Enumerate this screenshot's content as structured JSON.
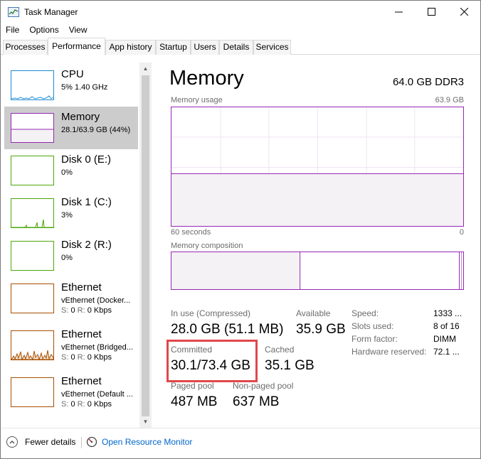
{
  "window": {
    "title": "Task Manager"
  },
  "menu": [
    "File",
    "Options",
    "View"
  ],
  "tabs": [
    "Processes",
    "Performance",
    "App history",
    "Startup",
    "Users",
    "Details",
    "Services"
  ],
  "sidebar": [
    {
      "name": "CPU",
      "sub": "5%  1.40 GHz",
      "color": "#1d8ad6"
    },
    {
      "name": "Memory",
      "sub": "28.1/63.9 GB (44%)",
      "color": "#9528b4"
    },
    {
      "name": "Disk 0 (E:)",
      "sub": "0%",
      "color": "#4da60c"
    },
    {
      "name": "Disk 1 (C:)",
      "sub": "3%",
      "color": "#4da60c"
    },
    {
      "name": "Disk 2 (R:)",
      "sub": "0%",
      "color": "#4da60c"
    },
    {
      "name": "Ethernet",
      "sub": "vEthernet (Docker...",
      "io_s": "S:",
      "io_s_val": "0",
      "io_r": "R:",
      "io_r_val": "0 Kbps",
      "color": "#a74f01"
    },
    {
      "name": "Ethernet",
      "sub": "vEthernet (Bridged...",
      "io_s": "S:",
      "io_s_val": "0",
      "io_r": "R:",
      "io_r_val": "0 Kbps",
      "color": "#a74f01"
    },
    {
      "name": "Ethernet",
      "sub": "vEthernet (Default ...",
      "io_s": "S:",
      "io_s_val": "0",
      "io_r": "R:",
      "io_r_val": "0 Kbps",
      "color": "#a74f01"
    }
  ],
  "main": {
    "title": "Memory",
    "spec": "64.0 GB DDR3",
    "usage_label": "Memory usage",
    "usage_max": "63.9 GB",
    "time_left": "60 seconds",
    "time_right": "0",
    "usage_fraction": 0.44,
    "composition_label": "Memory composition",
    "stats": {
      "in_use_label": "In use (Compressed)",
      "in_use_value": "28.0 GB (51.1 MB)",
      "available_label": "Available",
      "available_value": "35.9 GB",
      "committed_label": "Committed",
      "committed_value": "30.1/73.4 GB",
      "cached_label": "Cached",
      "cached_value": "35.1 GB",
      "paged_label": "Paged pool",
      "paged_value": "487 MB",
      "nonpaged_label": "Non-paged pool",
      "nonpaged_value": "637 MB"
    },
    "details": {
      "speed_label": "Speed:",
      "speed_value": "1333 ...",
      "slots_label": "Slots used:",
      "slots_value": "8 of 16",
      "form_label": "Form factor:",
      "form_value": "DIMM",
      "reserved_label": "Hardware reserved:",
      "reserved_value": "72.1 ..."
    }
  },
  "footer": {
    "fewer_details": "Fewer details",
    "resource_monitor": "Open Resource Monitor"
  },
  "colors": {
    "memory": "#9528b4",
    "memory_fill": "#f4f2f4",
    "highlight": "#e0474b",
    "link": "#0066cc"
  }
}
